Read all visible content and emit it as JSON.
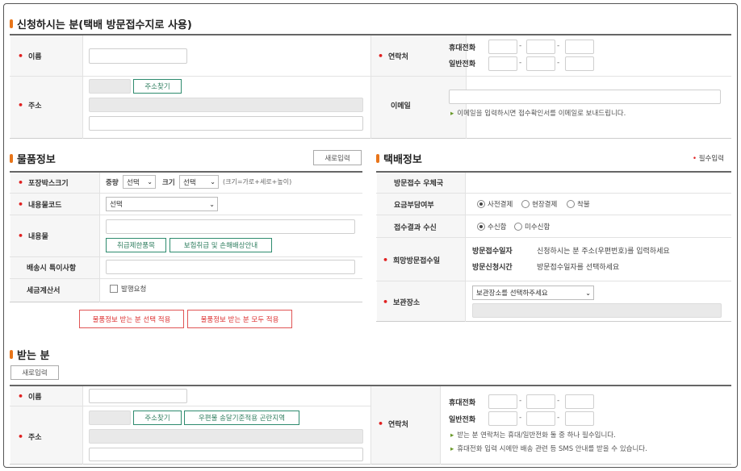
{
  "sender": {
    "title": "신청하시는 분(택배 방문접수지로 사용)",
    "name_label": "이름",
    "address_label": "주소",
    "address_search_btn": "주소찾기",
    "contact_label": "연락처",
    "mobile_label": "휴대전화",
    "phone_label": "일반전화",
    "email_label": "이메일",
    "email_hint": "이메일을 입력하시면 접수확인서를 이메일로 보내드립니다.",
    "dash": "-"
  },
  "item": {
    "title": "물품정보",
    "reset_btn": "새로입력",
    "box_size_label": "포장박스크기",
    "weight_label": "중량",
    "weight_value": "선택",
    "size_label": "크기",
    "size_value": "선택",
    "size_note": "(크기=가로+세로+높이)",
    "code_label": "내용물코드",
    "code_value": "선택",
    "contents_label": "내용물",
    "restrict_btn": "취급제한품목",
    "insurance_btn": "보험취급 및 손해배상안내",
    "note_label": "배송시 특이사항",
    "tax_label": "세금계산서",
    "tax_check_label": "발행요청",
    "apply_selected_btn": "물품정보 받는 분 선택 적용",
    "apply_all_btn": "물품정보 받는 분 모두 적용"
  },
  "delivery": {
    "title": "택배정보",
    "required_note": "필수입력",
    "post_office_label": "방문접수 우체국",
    "fee_label": "요금부담여부",
    "fee_options": [
      "사전결제",
      "현장결제",
      "착불"
    ],
    "result_label": "접수결과 수신",
    "result_options": [
      "수신함",
      "미수신함"
    ],
    "visit_label": "희망방문접수일",
    "visit_date_label": "방문접수일자",
    "visit_date_text": "신청하시는 분 주소(우편번호)를 입력하세요",
    "visit_time_label": "방문신청시간",
    "visit_time_text": "방문접수일자를 선택하세요",
    "storage_label": "보관장소",
    "storage_value": "보관장소를 선택하주세요"
  },
  "receiver": {
    "title": "받는 분",
    "reset_btn": "새로입력",
    "name_label": "이름",
    "address_label": "주소",
    "address_search_btn": "주소찾기",
    "remote_area_btn": "우편물 송달기준적용 곤란지역",
    "contact_label": "연락처",
    "mobile_label": "휴대전화",
    "phone_label": "일반전화",
    "hint1": "받는 분 연락처는 휴대/일반전화 둘 중 하나 필수입니다.",
    "hint2": "휴대전화 입력 시에만 배송 관련 등 SMS 안내를 받을 수 있습니다.",
    "dash": "-"
  },
  "colors": {
    "accent": "#e8751a",
    "required": "#e02020",
    "green": "#2e8b6e",
    "red_btn": "#e05555"
  }
}
